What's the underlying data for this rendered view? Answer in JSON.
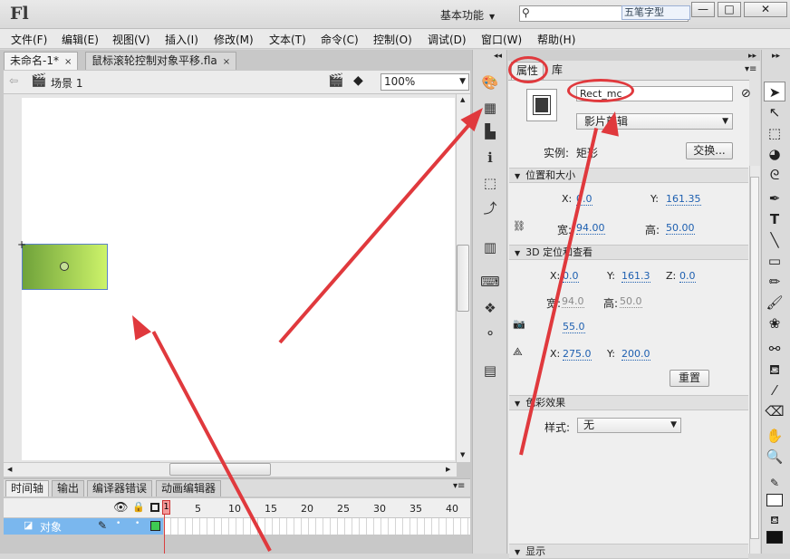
{
  "app": {
    "logo": "Fl",
    "workspace": "基本功能",
    "ime_label": "五笔字型"
  },
  "window_buttons": [
    "—",
    "□",
    "✕"
  ],
  "menu": [
    "文件(F)",
    "编辑(E)",
    "视图(V)",
    "插入(I)",
    "修改(M)",
    "文本(T)",
    "命令(C)",
    "控制(O)",
    "调试(D)",
    "窗口(W)",
    "帮助(H)"
  ],
  "doc_tabs": [
    {
      "label": "未命名-1*",
      "close": "×"
    },
    {
      "label": "鼠标滚轮控制对象平移.fla",
      "close": "×"
    }
  ],
  "scene": {
    "label": "场景 1",
    "zoom": "100%"
  },
  "timeline": {
    "tabs": [
      "时间轴",
      "输出",
      "编译器错误",
      "动画编辑器"
    ],
    "frame_numbers": [
      "1",
      "5",
      "10",
      "15",
      "20",
      "25",
      "30",
      "35",
      "40"
    ],
    "layer_name": "对象"
  },
  "panel": {
    "tabs": [
      "属性",
      "库"
    ],
    "instance_name": "Rect_mc",
    "symbol_type": "影片剪辑",
    "instance_label": "实例:",
    "instance_of": "矩形",
    "swap_label": "交换...",
    "pos_section": "位置和大小",
    "x_label": "X:",
    "x": "0.0",
    "y_label": "Y:",
    "y": "161.35",
    "w_label": "宽:",
    "w": "94.00",
    "h_label": "高:",
    "h": "50.00",
    "d3_section": "3D 定位和查看",
    "d3x": "0.0",
    "d3y": "161.3",
    "z_label": "Z:",
    "d3z": "0.0",
    "d3w": "94.0",
    "d3h": "50.0",
    "fov": "55.0",
    "vpx": "275.0",
    "vpy": "200.0",
    "reset_label": "重置",
    "color_section": "色彩效果",
    "style_label": "样式:",
    "style_value": "无",
    "bottom_section": "显示"
  },
  "colors": {
    "accent_red": "#e0393d",
    "selected_layer": "#7ab7ee",
    "rect_left": "#6fa23a",
    "rect_right": "#cdf36a"
  }
}
